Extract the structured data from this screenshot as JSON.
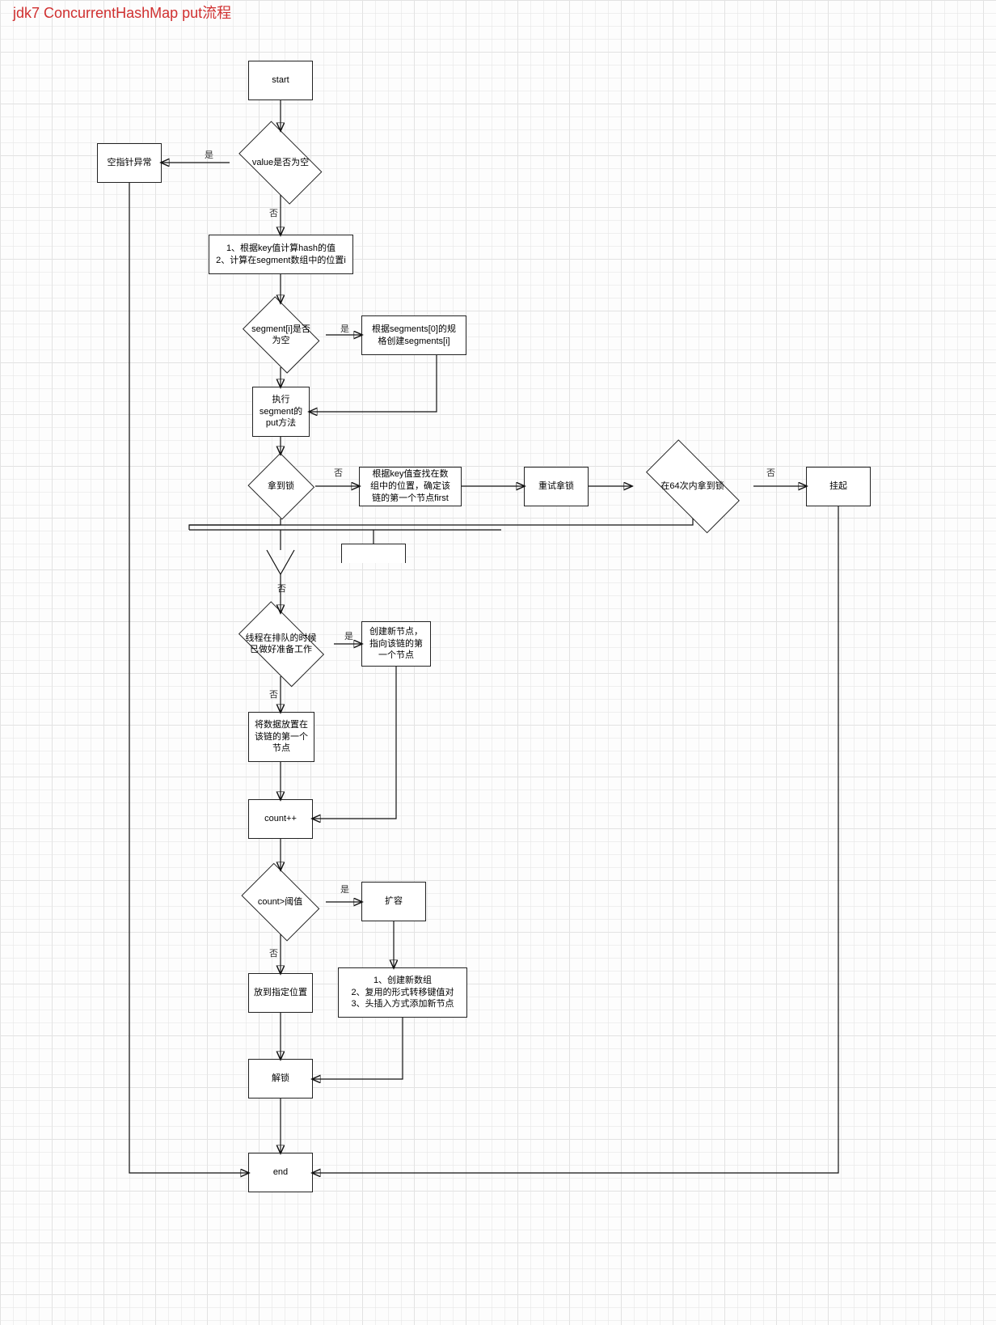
{
  "title": "jdk7 ConcurrentHashMap put流程",
  "nodes": {
    "start": "start",
    "npe": "空指针异常",
    "valueNull": "value是否为空",
    "hashCalc": "1、根据key值计算hash的值\n2、计算在segment数组中的位置i",
    "segNull": "segment[i]是否\n为空",
    "createSeg": "根据segments[0]的规\n格创建segments[i]",
    "segPut": "执行\nsegment的\nput方法",
    "gotLock": "拿到锁",
    "findFirst": "根据key值查找在数\n组中的位置，确定该\n链的第一个节点first",
    "retryLock": "重试拿锁",
    "in64": "在64次内拿到锁",
    "suspend": "挂起",
    "truncated": "",
    "prepared": "线程在排队的时候\n已做好准备工作",
    "newNodeFirst": "创建新节点，\n指向该链的第\n一个节点",
    "placeFirst": "将数据放置在\n该链的第一个\n节点",
    "countInc": "count++",
    "countGt": "count>阈值",
    "resize": "扩容",
    "placePos": "放到指定位置",
    "newArr": "1、创建新数组\n2、复用的形式转移键值对\n3、头插入方式添加新节点",
    "unlock": "解锁",
    "end": "end"
  },
  "edgeLabels": {
    "yes": "是",
    "no": "否"
  }
}
